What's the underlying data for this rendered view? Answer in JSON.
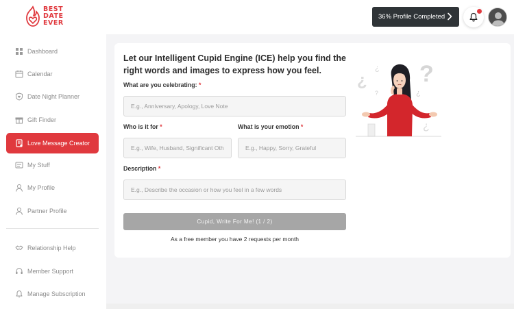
{
  "brand": {
    "line1": "BEST",
    "line2": "DATE",
    "line3": "EVER",
    "color": "#e0393e"
  },
  "header": {
    "profile_completion": "36% Profile Completed",
    "notification_indicator": true
  },
  "sidebar": {
    "items": [
      {
        "label": "Dashboard",
        "icon": "grid-icon"
      },
      {
        "label": "Calendar",
        "icon": "calendar-icon"
      },
      {
        "label": "Date Night Planner",
        "icon": "shield-heart-icon"
      },
      {
        "label": "Gift Finder",
        "icon": "gift-icon"
      },
      {
        "label": "Love Message Creator",
        "icon": "message-icon",
        "active": true
      },
      {
        "label": "My Stuff",
        "icon": "card-icon"
      },
      {
        "label": "My Profile",
        "icon": "user-icon"
      },
      {
        "label": "Partner Profile",
        "icon": "user-icon"
      }
    ],
    "secondary_items": [
      {
        "label": "Relationship Help",
        "icon": "handshake-icon"
      },
      {
        "label": "Member Support",
        "icon": "headset-icon"
      },
      {
        "label": "Manage Subscription",
        "icon": "bell-icon"
      }
    ]
  },
  "main": {
    "title": "Let our Intelligent Cupid Engine (ICE) help you find the right words and images to express how you feel.",
    "celebrating": {
      "label": "What are you celebrating:",
      "placeholder": "E.g., Anniversary, Apology, Love Note"
    },
    "who": {
      "label": "Who is it for",
      "placeholder": "E.g., Wife, Husband, Significant Oth"
    },
    "emotion": {
      "label": "What is your emotion",
      "placeholder": "E.g., Happy, Sorry, Grateful"
    },
    "description": {
      "label": "Description",
      "placeholder": "E.g., Describe the occasion or how you feel in a few words"
    },
    "required_mark": "*",
    "submit_label": "Cupid, Write For Me! (1 / 2)",
    "free_note": "As a free member you have 2 requests per month"
  },
  "colors": {
    "accent": "#e0393e",
    "dark_button": "#2f3437",
    "disabled_button": "#a6a6a6"
  }
}
